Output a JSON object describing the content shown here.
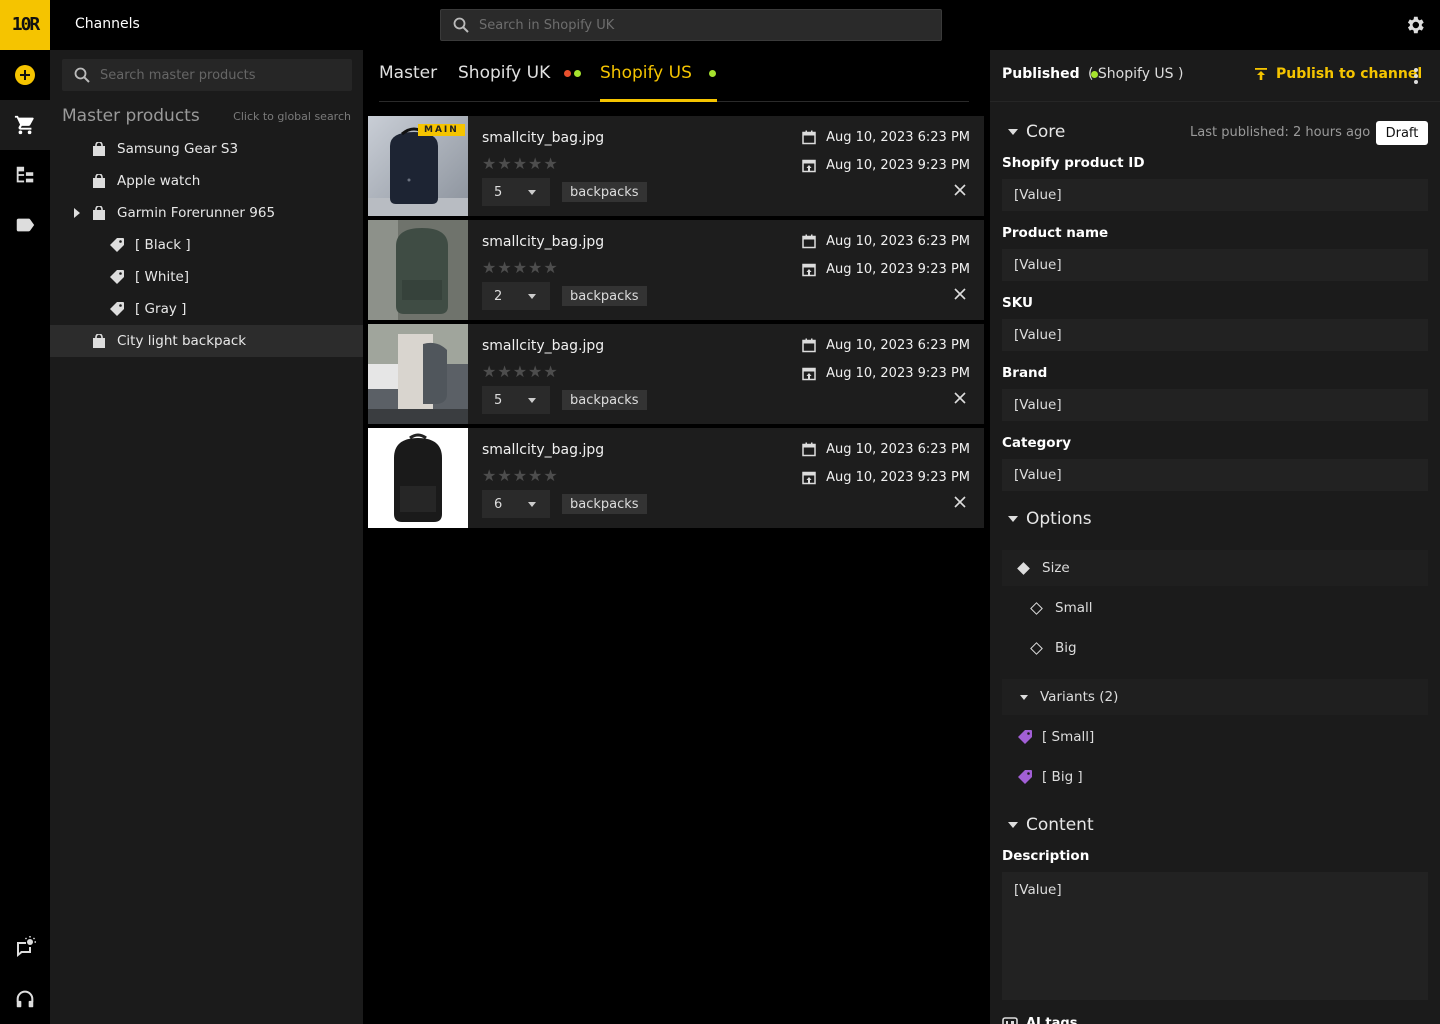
{
  "app": {
    "logo_text": "10R",
    "title": "Channels",
    "global_search_placeholder": "Search in Shopify UK"
  },
  "rail": {
    "icons": [
      "add-circle-icon",
      "cart-icon",
      "hierarchy-icon",
      "label-icon",
      "feedback-icon",
      "headset-icon"
    ]
  },
  "tree": {
    "search_placeholder": "Search master products",
    "header": "Master products",
    "hint": "Click to global search",
    "items": [
      {
        "label": "Samsung Gear S3"
      },
      {
        "label": "Apple watch"
      },
      {
        "label": "Garmin Forerunner 965"
      },
      {
        "label": "[ Black ]"
      },
      {
        "label": "[ White]"
      },
      {
        "label": "[ Gray ]"
      },
      {
        "label": "City light backpack"
      }
    ]
  },
  "tabs": [
    {
      "label": "Master"
    },
    {
      "label": "Shopify UK",
      "dots": [
        "#e8502d",
        "#a6e22e"
      ]
    },
    {
      "label": "Shopify US",
      "dots": [
        "#a6e22e"
      ]
    }
  ],
  "assets": [
    {
      "main_badge": "MAIN",
      "filename": "smallcity_bag.jpg",
      "stars": "★★★★★",
      "qty": "5",
      "tag": "backpacks",
      "date_created": "Aug 10, 2023 6:23 PM",
      "date_updated": "Aug 10, 2023 9:23 PM"
    },
    {
      "filename": "smallcity_bag.jpg",
      "stars": "★★★★★",
      "qty": "2",
      "tag": "backpacks",
      "date_created": "Aug 10, 2023 6:23 PM",
      "date_updated": "Aug 10, 2023 9:23 PM"
    },
    {
      "filename": "smallcity_bag.jpg",
      "stars": "★★★★★",
      "qty": "5",
      "tag": "backpacks",
      "date_created": "Aug 10, 2023 6:23 PM",
      "date_updated": "Aug 10, 2023 9:23 PM"
    },
    {
      "filename": "smallcity_bag.jpg",
      "stars": "★★★★★",
      "qty": "6",
      "tag": "backpacks",
      "date_created": "Aug 10, 2023 6:23 PM",
      "date_updated": "Aug 10, 2023 9:23 PM"
    }
  ],
  "right": {
    "status_label": "Published",
    "status_color": "#a6e22e",
    "channel": "( Shopify US )",
    "publish_button": "Publish to channel",
    "core": {
      "title": "Core",
      "last_published": "Last published: 2 hours ago",
      "draft_label": "Draft",
      "fields": [
        {
          "label": "Shopify product ID",
          "value": "[Value]"
        },
        {
          "label": "Product name",
          "value": "[Value]"
        },
        {
          "label": "SKU",
          "value": "[Value]"
        },
        {
          "label": "Brand",
          "value": "[Value]"
        },
        {
          "label": "Category",
          "value": "[Value]"
        }
      ]
    },
    "options": {
      "title": "Options",
      "option_name": "Size",
      "values": [
        "Small",
        "Big"
      ],
      "variants_label": "Variants (2)",
      "variants": [
        "[ Small]",
        "[ Big ]"
      ],
      "variant_tag_color": "#a25fd6"
    },
    "content": {
      "title": "Content",
      "description_label": "Description",
      "description_value": "[Value]",
      "ai_tags_label": "AI tags"
    }
  },
  "colors": {
    "accent": "#f5c400"
  }
}
